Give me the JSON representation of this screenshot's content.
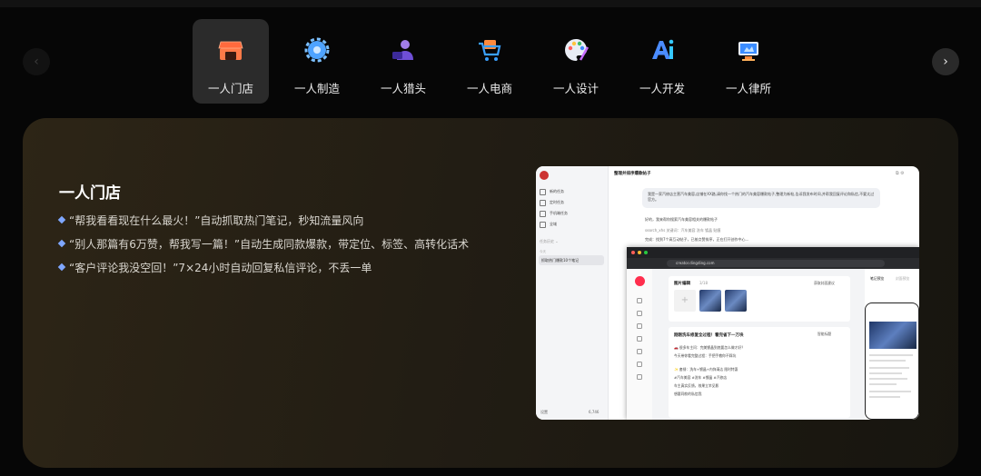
{
  "tabs": [
    {
      "label": "一人门店",
      "icon": "storefront-icon",
      "active": true
    },
    {
      "label": "一人制造",
      "icon": "gear-icon",
      "active": false
    },
    {
      "label": "一人猎头",
      "icon": "headhunter-icon",
      "active": false
    },
    {
      "label": "一人电商",
      "icon": "shopping-cart-icon",
      "active": false
    },
    {
      "label": "一人设计",
      "icon": "palette-icon",
      "active": false
    },
    {
      "label": "一人开发",
      "icon": "ai-icon",
      "active": false
    },
    {
      "label": "一人律所",
      "icon": "law-icon",
      "active": false
    }
  ],
  "nav": {
    "prev": "‹",
    "next": "›"
  },
  "panel": {
    "title": "一人门店",
    "features": [
      "“帮我看看现在什么最火！”自动抓取热门笔记，秒知流量风向",
      "“别人那篇有6万赞，帮我写一篇！”自动生成同款爆款，带定位、标签、高转化话术",
      "“客户评论我没空回！”7×24小时自动回复私信评论，不丢一单"
    ]
  },
  "shot": {
    "menu": [
      "新的任务",
      "定时任务",
      "手机端任务",
      "全域"
    ],
    "history_title": "任务历史 ⌄",
    "history_sub": "今天",
    "history_item": "抓取热门爆款10个笔记",
    "footer_left": "设置",
    "footer_right": "6,746",
    "header": "整理并排序爆款帖子",
    "bubble": "我是一家汽修店主营汽车美容,店铺在XX路,请你找一个热门的汽车美容爆款帖子,整理为新帖,告诉我发布时间,并帮我回复评论和私信,不要太过官方。",
    "p1": "好的，我来帮你搜索汽车美容相关的爆款帖子",
    "p2": "search_xhs 关键词：汽车美容 洗车 镀晶 贴膜",
    "p3": "完成：找到7个高互动帖子，已按点赞排序，正在打开创作中心…",
    "url": "creator.dingding.com",
    "card_title": "图片编辑",
    "card_count": "3/18",
    "card_btn": "获取封面建议",
    "post_title": "刚刚洗车修复全过程！看完省下一万块",
    "post_tag": "智能标题",
    "post_lines": [
      "🚗 很多车主问：完美镀晶到底要怎么做才好？",
      "今天带你看完整过程：手把手教你不踩坑",
      "",
      "✨ 套餐：洗车+镀晶+内饰清洁 限时特惠",
      "#汽车美容 #洗车 #镀晶 #汽修店",
      "车主真实反馈，效果立竿见影",
      "想要同款的私信我"
    ],
    "right_tab1": "笔记预览",
    "right_tab2": "封面预览"
  }
}
